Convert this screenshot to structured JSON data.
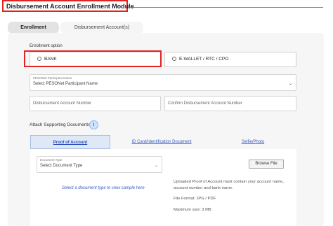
{
  "header": {
    "title": "Disbursement Account Enrollment Module"
  },
  "tabs": [
    {
      "label": "Enrollment",
      "active": true
    },
    {
      "label": "Disbursement Account(s)",
      "active": false
    }
  ],
  "enrollment": {
    "option_label": "Enrollment option",
    "options": [
      {
        "label": "BANK"
      },
      {
        "label": "E-WALLET / RTC / CPO"
      }
    ],
    "participant": {
      "label": "PESONet Participant Name",
      "placeholder": "Select PESONet Participant Name"
    },
    "account_number": {
      "placeholder": "Disbursement Account Number"
    },
    "confirm_account_number": {
      "placeholder": "Confirm Disbursement Account Number"
    }
  },
  "attachments": {
    "label": "Attach Supporting Documents",
    "info_icon": "info-icon",
    "doc_tabs": [
      {
        "label": "Proof of Account",
        "active": true
      },
      {
        "label": "ID Card/Identification Document",
        "active": false
      },
      {
        "label": "Selfie/Photo",
        "active": false
      }
    ],
    "document_type": {
      "label": "Document Type",
      "placeholder": "Select Document Type"
    },
    "sample_link": "Select a document type to view sample here",
    "browse_label": "Browse File",
    "upload_note": "Uploaded Proof of Account must contain your account name, account number and bank name.",
    "file_format": "File Format: JPG / PDF",
    "max_size": "Maximum size: 3 MB"
  },
  "colors": {
    "highlight": "#e02424",
    "link": "#3a5ec4",
    "accent": "#5a7bc7"
  }
}
